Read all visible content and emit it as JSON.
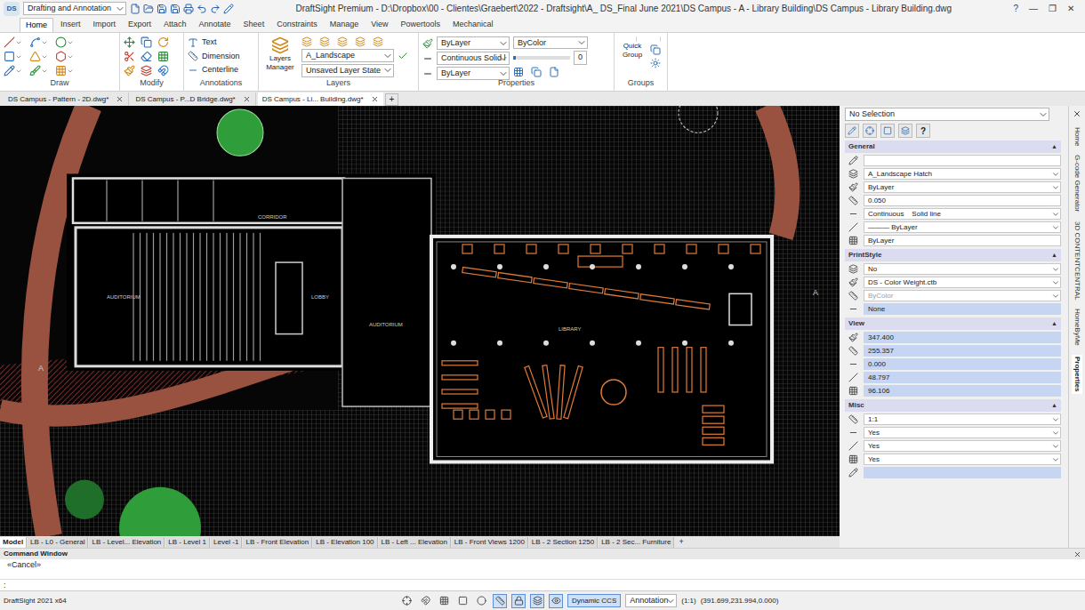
{
  "window": {
    "title": "DraftSight Premium - D:\\Dropbox\\00 - Clientes\\Graebert\\2022 - Draftsight\\A_ DS_Final June 2021\\DS Campus - A - Library Building\\DS Campus - Library Building.dwg",
    "workspace": "Drafting and Annotation",
    "logo": "DS",
    "controls": [
      "?",
      "—",
      "❐",
      "✕"
    ]
  },
  "ribbon_tabs": [
    {
      "label": "Home",
      "selected": true
    },
    {
      "label": "Insert",
      "selected": false
    },
    {
      "label": "Import",
      "selected": false
    },
    {
      "label": "Export",
      "selected": false
    },
    {
      "label": "Attach",
      "selected": false
    },
    {
      "label": "Annotate",
      "selected": false
    },
    {
      "label": "Sheet",
      "selected": false
    },
    {
      "label": "Constraints",
      "selected": false
    },
    {
      "label": "Manage",
      "selected": false
    },
    {
      "label": "View",
      "selected": false
    },
    {
      "label": "Powertools",
      "selected": false
    },
    {
      "label": "Mechanical",
      "selected": false
    }
  ],
  "ribbon": {
    "draw": {
      "label": "Draw"
    },
    "modify": {
      "label": "Modify"
    },
    "annotations": {
      "label": "Annotations",
      "items": [
        "Text",
        "Dimension",
        "Centerline"
      ]
    },
    "layers": {
      "label": "Layers",
      "manager": "Layers Manager",
      "layer": "A_Landscape",
      "state": "Unsaved Layer State"
    },
    "properties": {
      "label": "Properties",
      "color": "ByLayer",
      "print_color": "ByColor",
      "linetype": "Continuous",
      "linestyle": "Solid l",
      "lineweight": "ByLayer",
      "transparency": "0",
      "transparency_level": 0.05
    },
    "groups": {
      "label": "Groups",
      "quick_group": "Quick Group"
    }
  },
  "doc_tabs": [
    {
      "label": "DS Campus - Pattern - 2D.dwg*",
      "selected": false
    },
    {
      "label": "DS Campus - P...D Bridge.dwg*",
      "selected": false
    },
    {
      "label": "DS Campus - Li... Building.dwg*",
      "selected": true
    }
  ],
  "new_tab": "+",
  "canvas": {
    "labels": [
      "CORRIDOR",
      "AUDITORIUM",
      "LOBBY",
      "AUDITORIUM",
      "LIBRARY",
      "A",
      "A"
    ]
  },
  "properties_panel": {
    "selection": "No Selection",
    "help": "?",
    "sections": [
      {
        "title": "General",
        "toggle": "▲",
        "expanded": true,
        "rows": [
          {
            "value": "",
            "dropdown": false,
            "highlighted": false,
            "disabled": false
          },
          {
            "value": "A_Landscape Hatch",
            "dropdown": true,
            "highlighted": false,
            "disabled": false
          },
          {
            "value": "ByLayer",
            "dropdown": true,
            "highlighted": false,
            "disabled": false
          },
          {
            "value": "0.050",
            "dropdown": false,
            "highlighted": false,
            "disabled": false
          },
          {
            "value": "Continuous    Solid line",
            "dropdown": true,
            "highlighted": false,
            "disabled": false
          },
          {
            "value": "——— ByLayer",
            "dropdown": true,
            "highlighted": false,
            "disabled": false
          },
          {
            "value": "ByLayer",
            "dropdown": false,
            "highlighted": false,
            "disabled": false
          }
        ]
      },
      {
        "title": "PrintStyle",
        "toggle": "▲",
        "expanded": true,
        "rows": [
          {
            "value": "No",
            "dropdown": true,
            "highlighted": false,
            "disabled": false
          },
          {
            "value": "DS - Color Weight.ctb",
            "dropdown": true,
            "highlighted": false,
            "disabled": false
          },
          {
            "value": "ByColor",
            "dropdown": true,
            "highlighted": false,
            "disabled": true
          },
          {
            "value": "None",
            "dropdown": false,
            "highlighted": true,
            "disabled": false
          }
        ]
      },
      {
        "title": "View",
        "toggle": "▲",
        "expanded": true,
        "rows": [
          {
            "value": "347.400",
            "dropdown": false,
            "highlighted": true,
            "disabled": false
          },
          {
            "value": "255.357",
            "dropdown": false,
            "highlighted": true,
            "disabled": false
          },
          {
            "value": "0.000",
            "dropdown": false,
            "highlighted": true,
            "disabled": false
          },
          {
            "value": "48.797",
            "dropdown": false,
            "highlighted": true,
            "disabled": false
          },
          {
            "value": "96.106",
            "dropdown": false,
            "highlighted": true,
            "disabled": false
          }
        ]
      },
      {
        "title": "Misc",
        "toggle": "▲",
        "expanded": true,
        "rows": [
          {
            "value": "1:1",
            "dropdown": true,
            "highlighted": false,
            "disabled": false
          },
          {
            "value": "Yes",
            "dropdown": true,
            "highlighted": false,
            "disabled": false
          },
          {
            "value": "Yes",
            "dropdown": true,
            "highlighted": false,
            "disabled": false
          },
          {
            "value": "Yes",
            "dropdown": true,
            "highlighted": false,
            "disabled": false
          },
          {
            "value": "",
            "dropdown": false,
            "highlighted": true,
            "disabled": false
          }
        ]
      }
    ]
  },
  "side_tabs": [
    {
      "label": "Home",
      "selected": false
    },
    {
      "label": "G-code Generator",
      "selected": false
    },
    {
      "label": "3D CONTENTCENTRAL",
      "selected": false
    },
    {
      "label": "HomeByMe",
      "selected": false
    },
    {
      "label": "Properties",
      "selected": true
    }
  ],
  "layout_tabs": [
    {
      "label": "Model",
      "selected": true
    },
    {
      "label": "LB - L0 - General",
      "selected": false
    },
    {
      "label": "LB - Level... Elevation",
      "selected": false
    },
    {
      "label": "LB - Level 1",
      "selected": false
    },
    {
      "label": "Level -1",
      "selected": false
    },
    {
      "label": "LB - Front Elevation",
      "selected": false
    },
    {
      "label": "LB - Elevation 100",
      "selected": false
    },
    {
      "label": "LB - Left ... Elevation",
      "selected": false
    },
    {
      "label": "LB - Front Views 1200",
      "selected": false
    },
    {
      "label": "LB - 2 Section 1250",
      "selected": false
    },
    {
      "label": "LB - 2 Sec... Furniture",
      "selected": false
    }
  ],
  "command_window": {
    "title": "Command Window",
    "lines": [
      "«Cancel»"
    ],
    "prompt": ":"
  },
  "status_bar": {
    "app": "DraftSight 2021 x64",
    "toggles": [
      {
        "on": false
      },
      {
        "on": false
      },
      {
        "on": false
      },
      {
        "on": false
      },
      {
        "on": false
      },
      {
        "on": true
      },
      {
        "on": true
      },
      {
        "on": true
      },
      {
        "on": true
      }
    ],
    "dynamic_ccs": {
      "label": "Dynamic CCS",
      "on": true
    },
    "annotation": "Annotation",
    "scale": "(1:1)",
    "coords": "(391.699,231.994,0.000)"
  }
}
